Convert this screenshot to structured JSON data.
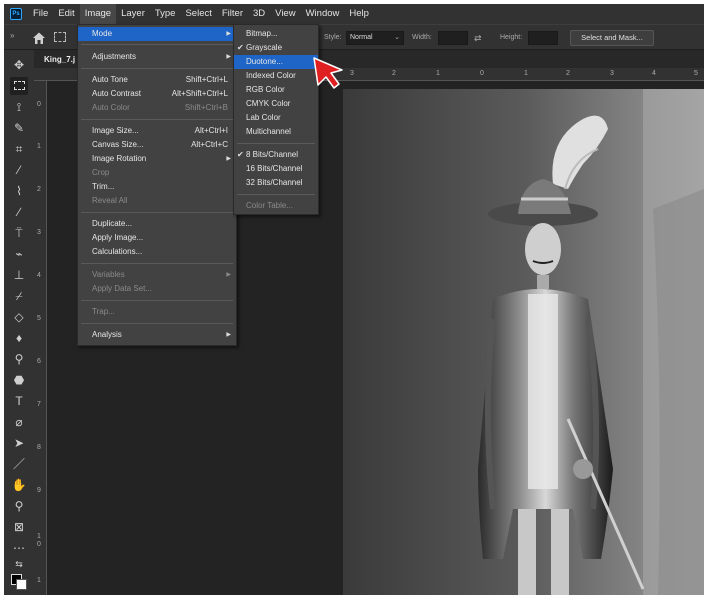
{
  "menubar": {
    "logo": "Ps",
    "items": [
      "File",
      "Edit",
      "Image",
      "Layer",
      "Type",
      "Select",
      "Filter",
      "3D",
      "View",
      "Window",
      "Help"
    ]
  },
  "options": {
    "style_label": "Style:",
    "style_value": "Normal",
    "width_label": "Width:",
    "height_label": "Height:",
    "select_mask_label": "Select and Mask..."
  },
  "document": {
    "tab_title": "King_7.j"
  },
  "ruler": {
    "h_numbers": [
      "3",
      "2",
      "1",
      "0",
      "1",
      "2",
      "3",
      "4",
      "5"
    ],
    "v_numbers": [
      "0",
      "1",
      "2",
      "3",
      "4",
      "5",
      "6",
      "7",
      "8",
      "9",
      "1\n0",
      "1"
    ]
  },
  "image_menu": {
    "items": [
      {
        "label": "Mode"
      },
      {
        "label": "Adjustments"
      },
      {
        "label": "Auto Tone",
        "shortcut": "Shift+Ctrl+L"
      },
      {
        "label": "Auto Contrast",
        "shortcut": "Alt+Shift+Ctrl+L"
      },
      {
        "label": "Auto Color",
        "shortcut": "Shift+Ctrl+B"
      },
      {
        "label": "Image Size...",
        "shortcut": "Alt+Ctrl+I"
      },
      {
        "label": "Canvas Size...",
        "shortcut": "Alt+Ctrl+C"
      },
      {
        "label": "Image Rotation"
      },
      {
        "label": "Crop"
      },
      {
        "label": "Trim..."
      },
      {
        "label": "Reveal All"
      },
      {
        "label": "Duplicate..."
      },
      {
        "label": "Apply Image..."
      },
      {
        "label": "Calculations..."
      },
      {
        "label": "Variables"
      },
      {
        "label": "Apply Data Set..."
      },
      {
        "label": "Trap..."
      },
      {
        "label": "Analysis"
      }
    ]
  },
  "mode_menu": {
    "items": [
      {
        "label": "Bitmap..."
      },
      {
        "label": "Grayscale"
      },
      {
        "label": "Duotone..."
      },
      {
        "label": "Indexed Color"
      },
      {
        "label": "RGB Color"
      },
      {
        "label": "CMYK Color"
      },
      {
        "label": "Lab Color"
      },
      {
        "label": "Multichannel"
      },
      {
        "label": "8 Bits/Channel"
      },
      {
        "label": "16 Bits/Channel"
      },
      {
        "label": "32 Bits/Channel"
      },
      {
        "label": "Color Table..."
      }
    ]
  },
  "colors": {
    "menu_highlight": "#1e65c7",
    "cursor": "#e02020"
  }
}
